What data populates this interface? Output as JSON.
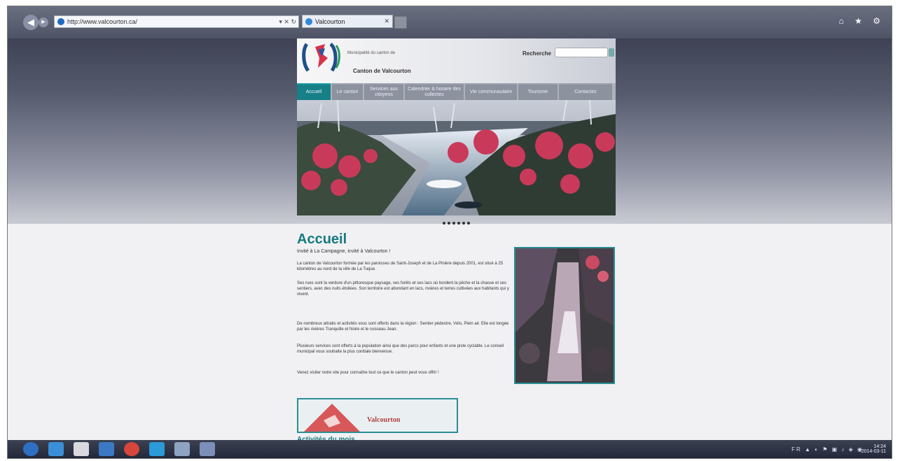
{
  "browser": {
    "back_glyph": "◀",
    "forward_glyph": "▶",
    "address_text": "http://www.valcourton.ca/",
    "address_controls": "▾ ✕ ↻",
    "tab_label": "Valcourton",
    "tab_close": "✕",
    "window_controls": "⌂ ★ ⚙",
    "icons": [
      "back-icon",
      "forward-icon",
      "site-favicon",
      "home-icon",
      "star-icon",
      "gear-icon"
    ]
  },
  "site": {
    "org_tagline": "Municipalité du canton de",
    "org_name": "Canton de Valcourton",
    "search_label": "Recherche",
    "search_value": "",
    "menu": [
      {
        "label": "Accueil",
        "active": true
      },
      {
        "label": "Le canton",
        "active": false
      },
      {
        "label": "Services aux citoyens",
        "active": false
      },
      {
        "label": "Calendrier & horaire des collectes",
        "active": false
      },
      {
        "label": "Vie communautaire",
        "active": false
      },
      {
        "label": "Tourisme",
        "active": false
      },
      {
        "label": "Contactez",
        "active": false
      }
    ],
    "slider_dots": 6
  },
  "content": {
    "heading": "Accueil",
    "subtitle": "Invité à La Campagne, invité à Valcourton !",
    "paragraphs": [
      "La canton de Valcourton formée par les paroisses de Saint-Joseph et de La Pinière depuis 2001, est situé à 25 kilomètres au nord de la ville de La Tuque.",
      "Ses rues sont la verdure d'un pittoresque paysage, ses forêts et ses lacs où bordent la pêche et la chasse et ses sentiers, avec des nuits étoilées. Son territoire est abondant en lacs, rivières et terres cultivées aux habitants qui y vivent.",
      "De nombreux attraits et activités vous sont offerts dans la région : Sentier pédestre, Vélo, Plein air. Elle est longée par les rivières Tranquille et Noire et le ruisseau Jean.",
      "Plusieurs services sont offerts à la population ainsi que des parcs pour enfants et une piste cyclable. Le conseil municipal vous souhaite la plus cordiale bienvenue.",
      "Venez visiter notre site pour connaître tout ce que le canton peut vous offrir !"
    ],
    "ad_text": "Valcourton",
    "bottom_link": "Activités du mois"
  },
  "taskbar": {
    "apps": [
      "start-icon",
      "explorer-icon",
      "folder-icon",
      "media-icon",
      "chrome-icon",
      "skype-icon",
      "word-icon",
      "app-icon"
    ],
    "tray_text": "FR ▲ ◐ ⚑ ▣ ♪ ◈ ◉",
    "clock_time": "14:24",
    "clock_date": "2014-03-11"
  },
  "colors": {
    "accent": "#177a80",
    "menu_active": "#177f86",
    "taskbar": "#2a2f40"
  }
}
